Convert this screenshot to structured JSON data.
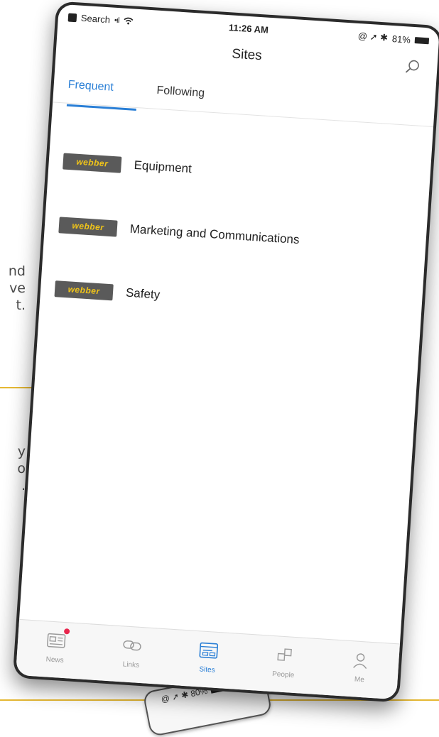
{
  "background": {
    "text_fragments": [
      "nd",
      "ve",
      "t.",
      "y",
      "o",
      "."
    ],
    "phone2_status": "80%"
  },
  "status_bar": {
    "carrier": "Search",
    "signal": "•ıl",
    "time": "11:26 AM",
    "icons": "@ ➚ ✱",
    "battery": "81%"
  },
  "nav": {
    "title": "Sites",
    "search_icon": "search-icon"
  },
  "tabs": [
    {
      "label": "Frequent",
      "active": true
    },
    {
      "label": "Following",
      "active": false
    }
  ],
  "sites": [
    {
      "name": "Equipment",
      "logo_text": "webber"
    },
    {
      "name": "Marketing and Communications",
      "logo_text": "webber"
    },
    {
      "name": "Safety",
      "logo_text": "webber"
    }
  ],
  "tab_bar": [
    {
      "label": "News",
      "icon": "news-icon",
      "badge": true
    },
    {
      "label": "Links",
      "icon": "links-icon"
    },
    {
      "label": "Sites",
      "icon": "sites-icon",
      "active": true
    },
    {
      "label": "People",
      "icon": "people-icon"
    },
    {
      "label": "Me",
      "icon": "person-icon"
    }
  ],
  "colors": {
    "accent": "#2a7fd6",
    "logo_bg": "#5a5a5a",
    "logo_text": "#f0c419",
    "rule": "#e5b833",
    "badge": "#e8264d"
  }
}
